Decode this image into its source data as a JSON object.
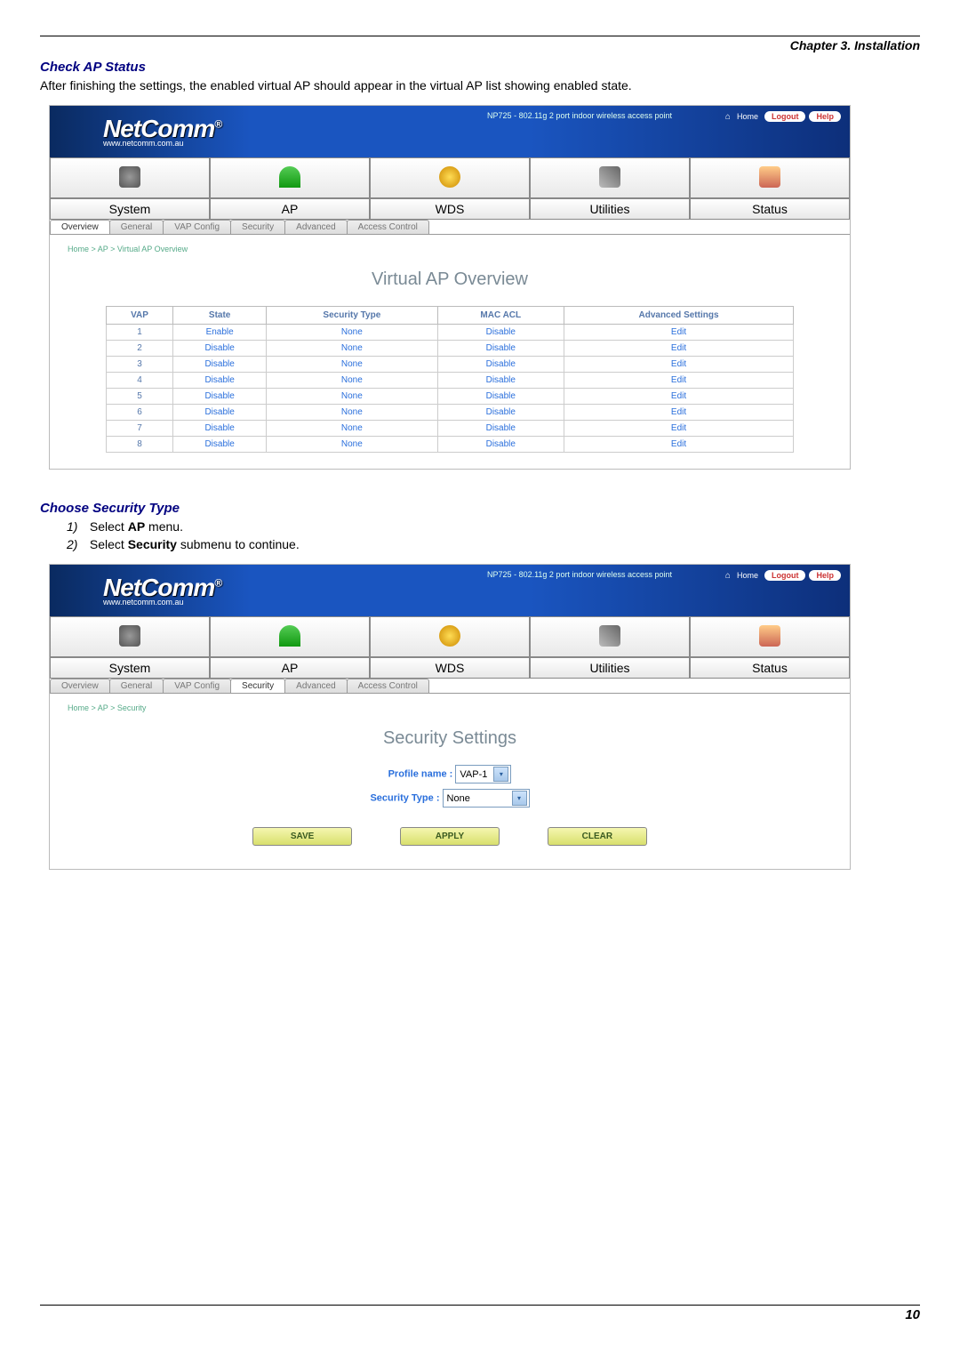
{
  "chapter": "Chapter 3. Installation",
  "section1": {
    "title": "Check AP Status",
    "desc": "After finishing the settings, the enabled virtual AP should appear in the virtual AP list showing enabled state."
  },
  "section2": {
    "title": "Choose Security Type",
    "step1_pre": "Select ",
    "step1_bold": "AP",
    "step1_post": " menu.",
    "step2_pre": "Select ",
    "step2_bold": "Security",
    "step2_post": " submenu to continue."
  },
  "brand": {
    "logo": "NetComm",
    "site": "www.netcomm.com.au",
    "product": "NP725 - 802.11g 2 port indoor wireless access point",
    "home": "Home",
    "logout": "Logout",
    "help": "Help"
  },
  "main_nav": [
    "System",
    "AP",
    "WDS",
    "Utilities",
    "Status"
  ],
  "subtabs": [
    "Overview",
    "General",
    "VAP Config",
    "Security",
    "Advanced",
    "Access Control"
  ],
  "shot1": {
    "active_subtab": "Overview",
    "breadcrumb": "Home > AP > Virtual AP Overview",
    "title": "Virtual AP Overview",
    "headers": [
      "VAP",
      "State",
      "Security Type",
      "MAC ACL",
      "Advanced Settings"
    ],
    "rows": [
      {
        "vap": "1",
        "state": "Enable",
        "sec": "None",
        "acl": "Disable",
        "adv": "Edit"
      },
      {
        "vap": "2",
        "state": "Disable",
        "sec": "None",
        "acl": "Disable",
        "adv": "Edit"
      },
      {
        "vap": "3",
        "state": "Disable",
        "sec": "None",
        "acl": "Disable",
        "adv": "Edit"
      },
      {
        "vap": "4",
        "state": "Disable",
        "sec": "None",
        "acl": "Disable",
        "adv": "Edit"
      },
      {
        "vap": "5",
        "state": "Disable",
        "sec": "None",
        "acl": "Disable",
        "adv": "Edit"
      },
      {
        "vap": "6",
        "state": "Disable",
        "sec": "None",
        "acl": "Disable",
        "adv": "Edit"
      },
      {
        "vap": "7",
        "state": "Disable",
        "sec": "None",
        "acl": "Disable",
        "adv": "Edit"
      },
      {
        "vap": "8",
        "state": "Disable",
        "sec": "None",
        "acl": "Disable",
        "adv": "Edit"
      }
    ]
  },
  "shot2": {
    "active_subtab": "Security",
    "breadcrumb": "Home > AP > Security",
    "title": "Security Settings",
    "profile_label": "Profile name :",
    "profile_value": "VAP-1",
    "sectype_label": "Security Type :",
    "sectype_value": "None",
    "buttons": {
      "save": "SAVE",
      "apply": "APPLY",
      "clear": "CLEAR"
    }
  },
  "page_number": "10"
}
